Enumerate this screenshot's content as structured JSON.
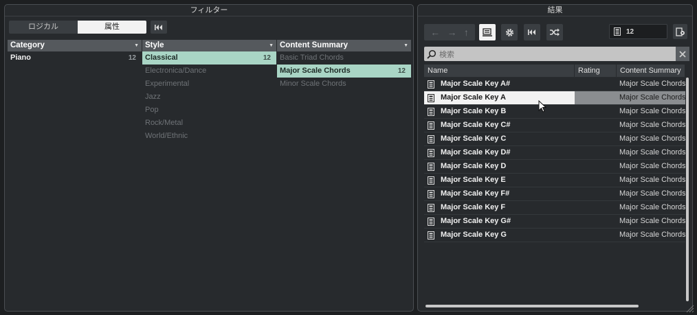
{
  "filter": {
    "title": "フィルター",
    "segment": {
      "logical": "ロジカル",
      "attribute": "属性"
    },
    "columns": [
      {
        "header": "Category",
        "rows": [
          {
            "label": "Piano",
            "count": "12",
            "state": "bold"
          }
        ]
      },
      {
        "header": "Style",
        "rows": [
          {
            "label": "Classical",
            "count": "12",
            "state": "sel"
          },
          {
            "label": "Electronica/Dance",
            "count": "",
            "state": "dim"
          },
          {
            "label": "Experimental",
            "count": "",
            "state": "dim"
          },
          {
            "label": "Jazz",
            "count": "",
            "state": "dim"
          },
          {
            "label": "Pop",
            "count": "",
            "state": "dim"
          },
          {
            "label": "Rock/Metal",
            "count": "",
            "state": "dim"
          },
          {
            "label": "World/Ethnic",
            "count": "",
            "state": "dim"
          }
        ]
      },
      {
        "header": "Content Summary",
        "rows": [
          {
            "label": "Basic Triad Chords",
            "count": "",
            "state": "dim"
          },
          {
            "label": "Major Scale Chords",
            "count": "12",
            "state": "sel"
          },
          {
            "label": "Minor Scale Chords",
            "count": "",
            "state": "dim"
          }
        ]
      }
    ]
  },
  "results": {
    "title": "結果",
    "count": "12",
    "search_placeholder": "検索",
    "columns": {
      "name": "Name",
      "rating": "Rating",
      "summary": "Content Summary"
    },
    "rows": [
      {
        "name": "Major Scale Key A#",
        "summary": "Major Scale Chords",
        "selected": false
      },
      {
        "name": "Major Scale Key A",
        "summary": "Major Scale Chords",
        "selected": true
      },
      {
        "name": "Major Scale Key B",
        "summary": "Major Scale Chords",
        "selected": false
      },
      {
        "name": "Major Scale Key C#",
        "summary": "Major Scale Chords",
        "selected": false
      },
      {
        "name": "Major Scale Key C",
        "summary": "Major Scale Chords",
        "selected": false
      },
      {
        "name": "Major Scale Key D#",
        "summary": "Major Scale Chords",
        "selected": false
      },
      {
        "name": "Major Scale Key D",
        "summary": "Major Scale Chords",
        "selected": false
      },
      {
        "name": "Major Scale Key E",
        "summary": "Major Scale Chords",
        "selected": false
      },
      {
        "name": "Major Scale Key F#",
        "summary": "Major Scale Chords",
        "selected": false
      },
      {
        "name": "Major Scale Key F",
        "summary": "Major Scale Chords",
        "selected": false
      },
      {
        "name": "Major Scale Key G#",
        "summary": "Major Scale Chords",
        "selected": false
      },
      {
        "name": "Major Scale Key G",
        "summary": "Major Scale Chords",
        "selected": false
      }
    ]
  },
  "icons": {
    "nav": [
      "back-arrow-icon",
      "forward-arrow-icon",
      "up-arrow-icon"
    ],
    "toolbar": [
      "folder-view-icon",
      "settings-gear-icon",
      "rewind-icon",
      "shuffle-icon"
    ],
    "row": "chord-track-icon",
    "counter": "chord-track-icon",
    "export": "export-icon",
    "search": "search-icon",
    "clear": "close-icon"
  },
  "colors": {
    "selection": "#a9d5c5",
    "panel": "#272a2d",
    "header": "#55595d"
  }
}
